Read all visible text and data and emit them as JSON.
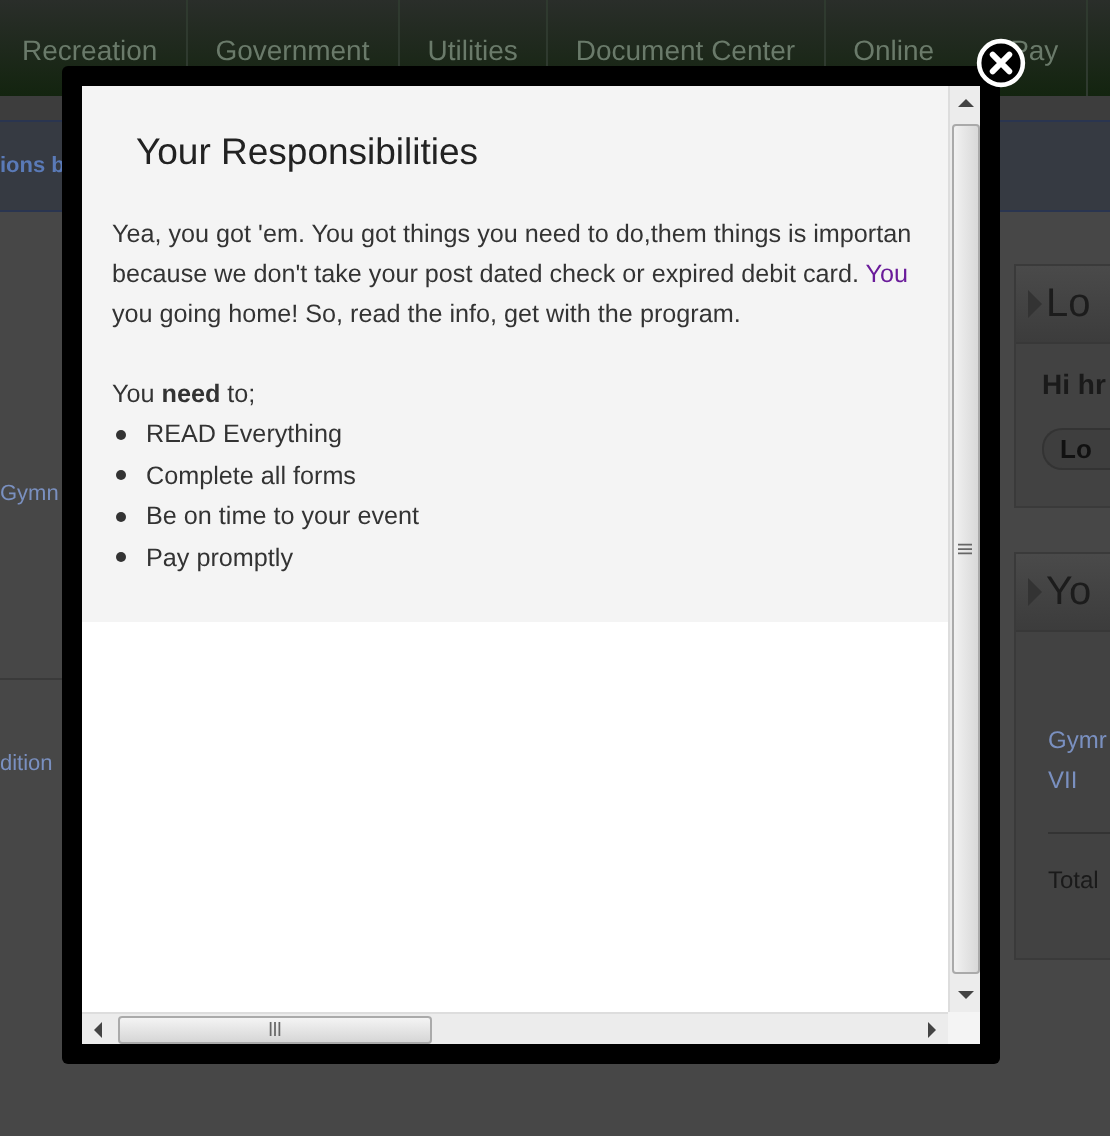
{
  "nav": {
    "items": [
      {
        "label": "Recreation"
      },
      {
        "label": "Government"
      },
      {
        "label": "Utilities"
      },
      {
        "label": "Document Center"
      },
      {
        "label": "Online",
        "label_end": "Pay"
      }
    ]
  },
  "background": {
    "banner_text": "ions b",
    "left": {
      "items": [
        "Gymn",
        "dition"
      ]
    },
    "panels": [
      {
        "heading": "Lo",
        "greeting": "Hi hr",
        "button": "Lo"
      },
      {
        "heading": "Yo",
        "link_lines": [
          "Gymr",
          "VII"
        ],
        "total": "Total"
      }
    ]
  },
  "dialog": {
    "title": "Your Responsibilities",
    "paragraph": [
      {
        "text": "Yea, you got 'em. You got things you need to do,them things is importan"
      },
      {
        "text": "because we don't take your post dated check or expired debit card. ",
        "link": "You"
      },
      {
        "text": "you going home! So, read the info, get with the program."
      }
    ],
    "intro": "You **need** to;",
    "list": [
      "READ Everything",
      "Complete all forms",
      "Be on time to your event",
      "Pay promptly"
    ]
  }
}
